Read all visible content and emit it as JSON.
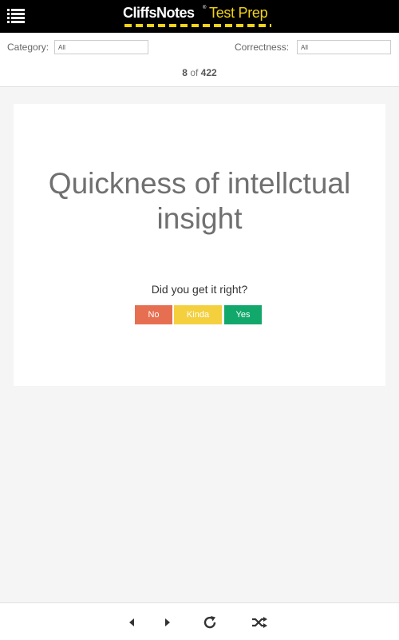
{
  "header": {
    "logo_brand": "CliffsNotes",
    "logo_reg": "®",
    "logo_product": "Test Prep",
    "icons": {
      "menu": "hamburger-menu-icon"
    }
  },
  "filters": {
    "category_label": "Category:",
    "category_value": "All",
    "correctness_label": "Correctness:",
    "correctness_value": "All"
  },
  "counter": {
    "current": "8",
    "of": "of",
    "total": "422"
  },
  "card": {
    "term": "Quickness of intellctual insight",
    "question": "Did you get it right?",
    "buttons": {
      "no": "No",
      "kinda": "Kinda",
      "yes": "Yes"
    }
  },
  "bottom_nav": {
    "icons": [
      "previous-icon",
      "next-icon",
      "refresh-icon",
      "shuffle-icon"
    ]
  },
  "colors": {
    "header_bg": "#000000",
    "logo_accent": "#f2d316",
    "no": "#e76f51",
    "kinda": "#f4d03f",
    "yes": "#12a86b"
  }
}
